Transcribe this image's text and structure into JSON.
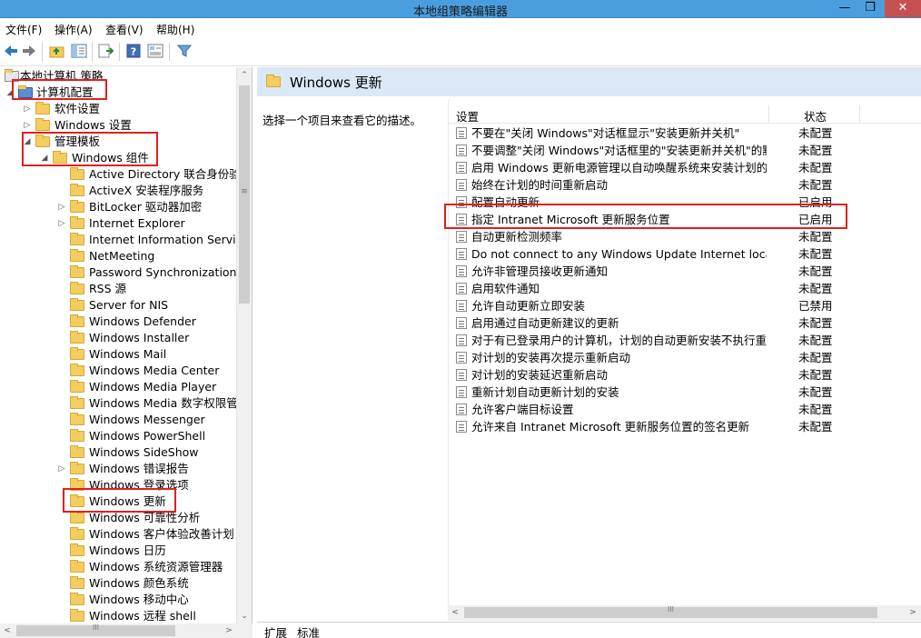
{
  "window": {
    "title": "本地组策略编辑器",
    "min": "—",
    "max": "❐",
    "close": "✕"
  },
  "menu": [
    "文件(F)",
    "操作(A)",
    "查看(V)",
    "帮助(H)"
  ],
  "toolbar": {
    "back_icon": "back-arrow-icon",
    "forward_icon": "forward-arrow-icon",
    "up_icon": "folder-up-icon",
    "show_tree_icon": "show-hide-tree-icon",
    "export_icon": "export-list-icon",
    "help_icon": "help-icon",
    "properties_icon": "properties-icon",
    "filter_icon": "filter-icon"
  },
  "tree": {
    "items": [
      {
        "label": "本地计算机 策略",
        "level": 0,
        "expander": "",
        "icon": "policy"
      },
      {
        "label": "计算机配置",
        "level": 1,
        "expander": "◢",
        "icon": "computer"
      },
      {
        "label": "软件设置",
        "level": 2,
        "expander": "▷",
        "icon": "folder"
      },
      {
        "label": "Windows 设置",
        "level": 2,
        "expander": "▷",
        "icon": "folder"
      },
      {
        "label": "管理模板",
        "level": 2,
        "expander": "◢",
        "icon": "folder"
      },
      {
        "label": "Windows 组件",
        "level": 3,
        "expander": "◢",
        "icon": "folder"
      },
      {
        "label": "Active Directory 联合身份验证",
        "level": 4,
        "expander": "",
        "icon": "folder"
      },
      {
        "label": "ActiveX 安装程序服务",
        "level": 4,
        "expander": "",
        "icon": "folder"
      },
      {
        "label": "BitLocker 驱动器加密",
        "level": 4,
        "expander": "▷",
        "icon": "folder"
      },
      {
        "label": "Internet Explorer",
        "level": 4,
        "expander": "▷",
        "icon": "folder"
      },
      {
        "label": "Internet Information Service",
        "level": 4,
        "expander": "",
        "icon": "folder"
      },
      {
        "label": "NetMeeting",
        "level": 4,
        "expander": "",
        "icon": "folder"
      },
      {
        "label": "Password Synchronization",
        "level": 4,
        "expander": "",
        "icon": "folder"
      },
      {
        "label": "RSS 源",
        "level": 4,
        "expander": "",
        "icon": "folder"
      },
      {
        "label": "Server for NIS",
        "level": 4,
        "expander": "",
        "icon": "folder"
      },
      {
        "label": "Windows Defender",
        "level": 4,
        "expander": "",
        "icon": "folder"
      },
      {
        "label": "Windows Installer",
        "level": 4,
        "expander": "",
        "icon": "folder"
      },
      {
        "label": "Windows Mail",
        "level": 4,
        "expander": "",
        "icon": "folder"
      },
      {
        "label": "Windows Media Center",
        "level": 4,
        "expander": "",
        "icon": "folder"
      },
      {
        "label": "Windows Media Player",
        "level": 4,
        "expander": "",
        "icon": "folder"
      },
      {
        "label": "Windows Media 数字权限管理",
        "level": 4,
        "expander": "",
        "icon": "folder"
      },
      {
        "label": "Windows Messenger",
        "level": 4,
        "expander": "",
        "icon": "folder"
      },
      {
        "label": "Windows PowerShell",
        "level": 4,
        "expander": "",
        "icon": "folder"
      },
      {
        "label": "Windows SideShow",
        "level": 4,
        "expander": "",
        "icon": "folder"
      },
      {
        "label": "Windows 错误报告",
        "level": 4,
        "expander": "▷",
        "icon": "folder"
      },
      {
        "label": "Windows 登录选项",
        "level": 4,
        "expander": "",
        "icon": "folder"
      },
      {
        "label": "Windows 更新",
        "level": 4,
        "expander": "",
        "icon": "folder"
      },
      {
        "label": "Windows 可靠性分析",
        "level": 4,
        "expander": "",
        "icon": "folder"
      },
      {
        "label": "Windows 客户体验改善计划",
        "level": 4,
        "expander": "",
        "icon": "folder"
      },
      {
        "label": "Windows 日历",
        "level": 4,
        "expander": "",
        "icon": "folder"
      },
      {
        "label": "Windows 系统资源管理器",
        "level": 4,
        "expander": "",
        "icon": "folder"
      },
      {
        "label": "Windows 颜色系统",
        "level": 4,
        "expander": "",
        "icon": "folder"
      },
      {
        "label": "Windows 移动中心",
        "level": 4,
        "expander": "",
        "icon": "folder"
      },
      {
        "label": "Windows 远程 shell",
        "level": 4,
        "expander": "",
        "icon": "folder"
      }
    ]
  },
  "scroll": {
    "up": "⌃",
    "down": "⌄",
    "left": "<",
    "right": ">",
    "grip": "≡",
    "hgrip": "III"
  },
  "right": {
    "title": "Windows 更新",
    "description": "选择一个项目来查看它的描述。",
    "columns": {
      "setting": "设置",
      "state": "状态"
    },
    "rows": [
      {
        "name": "不要在\"关闭 Windows\"对话框显示\"安装更新并关机\"",
        "state": "未配置"
      },
      {
        "name": "不要调整\"关闭 Windows\"对话框里的\"安装更新并关机\"的默...",
        "state": "未配置"
      },
      {
        "name": "启用 Windows 更新电源管理以自动唤醒系统来安装计划的...",
        "state": "未配置"
      },
      {
        "name": "始终在计划的时间重新启动",
        "state": "未配置"
      },
      {
        "name": "配置自动更新",
        "state": "已启用"
      },
      {
        "name": "指定 Intranet Microsoft 更新服务位置",
        "state": "已启用"
      },
      {
        "name": "自动更新检测频率",
        "state": "未配置"
      },
      {
        "name": "Do not connect to any Windows Update Internet locati...",
        "state": "未配置"
      },
      {
        "name": "允许非管理员接收更新通知",
        "state": "未配置"
      },
      {
        "name": "启用软件通知",
        "state": "未配置"
      },
      {
        "name": "允许自动更新立即安装",
        "state": "已禁用"
      },
      {
        "name": "启用通过自动更新建议的更新",
        "state": "未配置"
      },
      {
        "name": "对于有已登录用户的计算机，计划的自动更新安装不执行重...",
        "state": "未配置"
      },
      {
        "name": "对计划的安装再次提示重新启动",
        "state": "未配置"
      },
      {
        "name": "对计划的安装延迟重新启动",
        "state": "未配置"
      },
      {
        "name": "重新计划自动更新计划的安装",
        "state": "未配置"
      },
      {
        "name": "允许客户端目标设置",
        "state": "未配置"
      },
      {
        "name": "允许来自 Intranet Microsoft 更新服务位置的签名更新",
        "state": "未配置"
      }
    ],
    "tabs": [
      "扩展",
      "标准"
    ]
  },
  "colors": {
    "titlebar": "#4a9ede",
    "header": "#dbe8f7",
    "highlight_box": "#e02020",
    "close": "#c75050"
  }
}
